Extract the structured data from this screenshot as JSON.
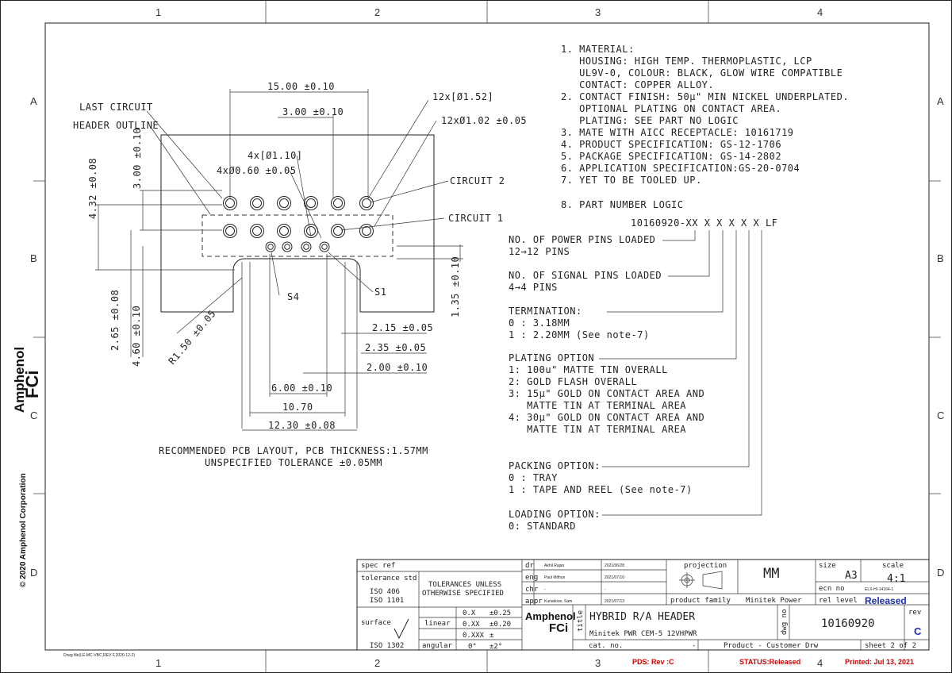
{
  "zones": {
    "columns": [
      "1",
      "2",
      "3",
      "4"
    ],
    "rows": [
      "A",
      "B",
      "C",
      "D"
    ]
  },
  "side": {
    "brand_top": "Amphenol",
    "brand_bottom": "FCi",
    "copyright": "© 2020 Amphenol Corporation"
  },
  "drawing": {
    "dims": {
      "d15": "15.00 ±0.10",
      "d3h": "3.00 ±0.10",
      "d12x152": "12x[Ø1.52]",
      "d12x102": "12xØ1.02 ±0.05",
      "d4x110": "4x[Ø1.10]",
      "d4x060": "4xØ0.60 ±0.05",
      "d432": "4.32 ±0.08",
      "d3v": "3.00 ±0.10",
      "d265": "2.65 ±0.08",
      "d460": "4.60 ±0.10",
      "r150": "R1.50 ±0.05",
      "d135": "1.35 ±0.10",
      "d215": "2.15 ±0.05",
      "d235": "2.35 ±0.05",
      "d200": "2.00 ±0.10",
      "d600": "6.00 ±0.10",
      "d1070": "10.70",
      "d1230": "12.30 ±0.08"
    },
    "labels": {
      "last_circuit": "LAST CIRCUIT",
      "header_outline": "HEADER OUTLINE",
      "circuit2": "CIRCUIT 2",
      "circuit1": "CIRCUIT 1",
      "s4": "S4",
      "s1": "S1"
    },
    "caption1": "RECOMMENDED PCB LAYOUT, PCB THICKNESS:1.57MM",
    "caption2": "UNSPECIFIED TOLERANCE ±0.05MM"
  },
  "notes": [
    "1. MATERIAL:",
    "   HOUSING: HIGH TEMP. THERMOPLASTIC, LCP",
    "   UL9V-0, COLOUR: BLACK, GLOW WIRE COMPATIBLE",
    "   CONTACT: COPPER ALLOY.",
    "2. CONTACT FINISH: 50µ\" MIN NICKEL UNDERPLATED.",
    "   OPTIONAL PLATING ON CONTACT AREA.",
    "   PLATING: SEE PART NO LOGIC",
    "3. MATE WITH AICC RECEPTACLE: 10161719",
    "4. PRODUCT SPECIFICATION: GS-12-1706",
    "5. PACKAGE SPECIFICATION: GS-14-2802",
    "6. APPLICATION SPECIFICATION:GS-20-0704",
    "7. YET TO BE TOOLED UP."
  ],
  "part_logic": {
    "heading": "8. PART NUMBER LOGIC",
    "part_number": "10160920-XX X X X X X LF",
    "groups": [
      {
        "lines": [
          "NO. OF POWER PINS LOADED",
          "12→12 PINS"
        ]
      },
      {
        "lines": [
          "NO. OF SIGNAL PINS LOADED",
          "4→4 PINS"
        ]
      },
      {
        "lines": [
          "TERMINATION:",
          "0 : 3.18MM",
          "1 : 2.20MM (See note-7)"
        ]
      },
      {
        "lines": [
          "PLATING OPTION",
          "1: 100u\" MATTE TIN OVERALL",
          "2: GOLD FLASH OVERALL",
          "3: 15µ\" GOLD ON CONTACT AREA AND",
          "   MATTE TIN AT TERMINAL AREA",
          "4: 30µ\" GOLD ON CONTACT AREA AND",
          "   MATTE TIN AT TERMINAL AREA"
        ]
      },
      {
        "lines": [
          "PACKING OPTION:",
          "0 : TRAY",
          "1 : TAPE AND REEL (See note-7)"
        ]
      },
      {
        "lines": [
          "LOADING OPTION:",
          "0: STANDARD"
        ]
      }
    ]
  },
  "title_block": {
    "spec_ref": "spec ref",
    "tolerance_std": "tolerance std",
    "iso406": "ISO 406",
    "iso1101": "ISO 1101",
    "tol_text1": "TOLERANCES UNLESS",
    "tol_text2": "OTHERWISE SPECIFIED",
    "surface": "surface",
    "iso1302": "ISO 1302",
    "linear": "linear",
    "angular": "angular",
    "tol_rows": [
      {
        "k": "0.X",
        "v": "±0.25"
      },
      {
        "k": "0.XX",
        "v": "±0.20"
      },
      {
        "k": "0.XXX",
        "v": "±"
      },
      {
        "k": "0°",
        "v": "±2°"
      }
    ],
    "roles": [
      {
        "role": "dr",
        "name": "Akhil Rajan",
        "date": "2021/06/28"
      },
      {
        "role": "eng",
        "name": "Paul Mithun",
        "date": "2021/07/10"
      },
      {
        "role": "chr",
        "name": "-",
        "date": "-"
      },
      {
        "role": "appr",
        "name": "Kuriakose, Sam",
        "date": "2021/07/13"
      }
    ],
    "logo_top": "Amphenol",
    "logo_bottom": "FCi",
    "title_label": "title",
    "title": "HYBRID R/A HEADER",
    "subtitle": "Minitek PWR CEM-5 12VHPWR",
    "cat_no": "cat. no.",
    "cat_dash": "-",
    "projection": "projection",
    "units": "MM",
    "product_family_label": "product family",
    "product_family": "Minitek Power",
    "size_label": "size",
    "size": "A3",
    "scale_label": "scale",
    "scale": "4:1",
    "ecn_label": "ecn no",
    "ecn": "ELX-HI-14164-1",
    "rel_level_label": "rel level",
    "rel_level": "Released",
    "dwg_label": "dwg no",
    "dwg_no": "10160920",
    "rev_label": "rev",
    "rev": "C",
    "product_type": "Product - Customer Drw",
    "sheet": "sheet 2 of 2"
  },
  "footer": {
    "file": "Drwg file(LE-MC-VBC,REV F,2020-12-2)",
    "pds": "PDS: Rev :C",
    "status": "STATUS:Released",
    "printed": "Printed:  Jul 13, 2021"
  }
}
